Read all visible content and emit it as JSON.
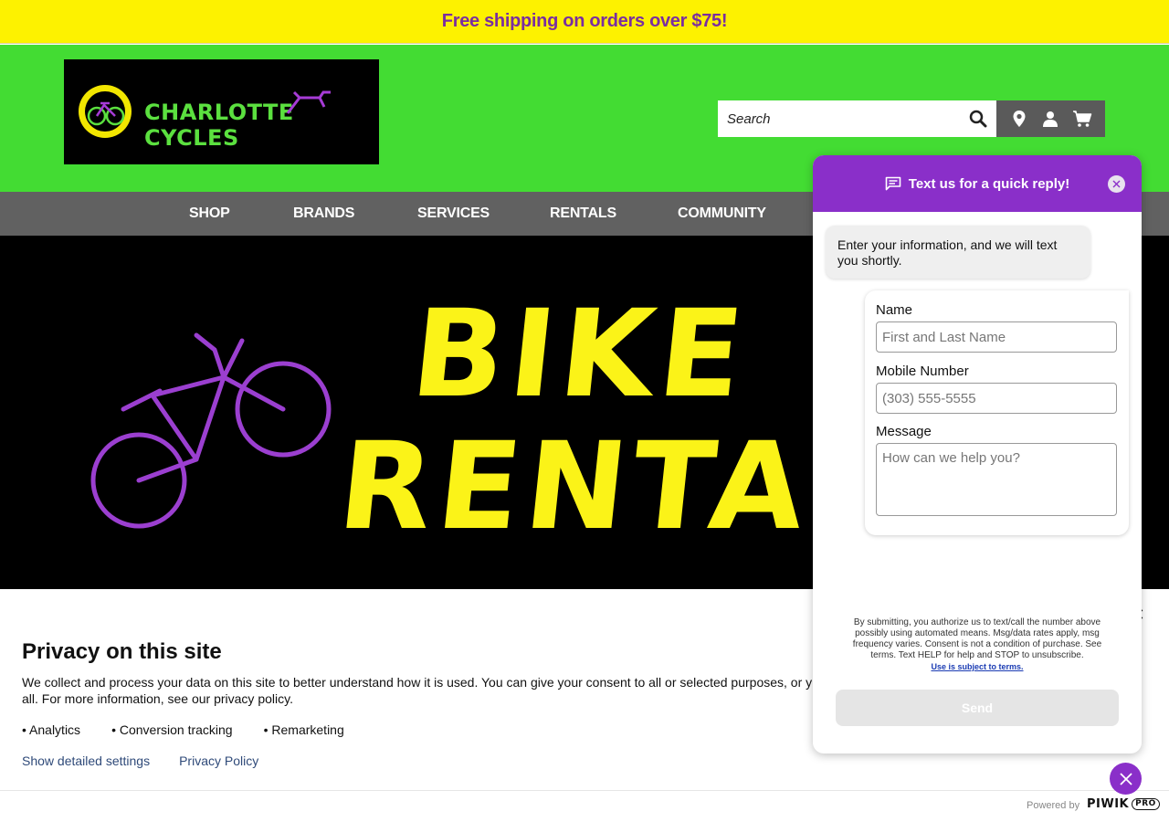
{
  "promo": {
    "text": "Free shipping on orders over $75!"
  },
  "header": {
    "logo_text": "CHARLOTTE CYCLES",
    "search_placeholder": "Search"
  },
  "nav": {
    "items": [
      "SHOP",
      "BRANDS",
      "SERVICES",
      "RENTALS",
      "COMMUNITY"
    ]
  },
  "hero": {
    "line1": "BIKE",
    "line2": "RENTALS"
  },
  "privacy": {
    "title": "Privacy on this site",
    "body": "We collect and process your data on this site to better understand how it is used. You can give your consent to all or selected purposes, or y",
    "body_line2": "all. For more information, see our privacy policy.",
    "purposes": [
      "Analytics",
      "Conversion tracking",
      "Remarketing"
    ],
    "links": [
      "Show detailed settings",
      "Privacy Policy"
    ],
    "powered_by": "Powered by",
    "piwik": "PIWIK",
    "piwik_pro": "PRO"
  },
  "chat": {
    "title": "Text us for a quick reply!",
    "intro": "Enter your information, and we will text you shortly.",
    "name_label": "Name",
    "name_placeholder": "First and Last Name",
    "mobile_label": "Mobile Number",
    "mobile_placeholder": "(303) 555-5555",
    "message_label": "Message",
    "message_placeholder": "How can we help you?",
    "disclaimer": "By submitting, you authorize us to text/call the number above possibly using automated means. Msg/data rates apply, msg frequency varies. Consent is not a condition of purchase. See terms. Text HELP for help and STOP to unsubscribe.",
    "terms_link": "Use is subject to terms.",
    "send_label": "Send"
  },
  "colors": {
    "promo_bg": "#fdf200",
    "header_green": "#43dc33",
    "nav_gray": "#616161",
    "accent_purple": "#8a2fc9",
    "hero_yellow": "#fbf318"
  }
}
